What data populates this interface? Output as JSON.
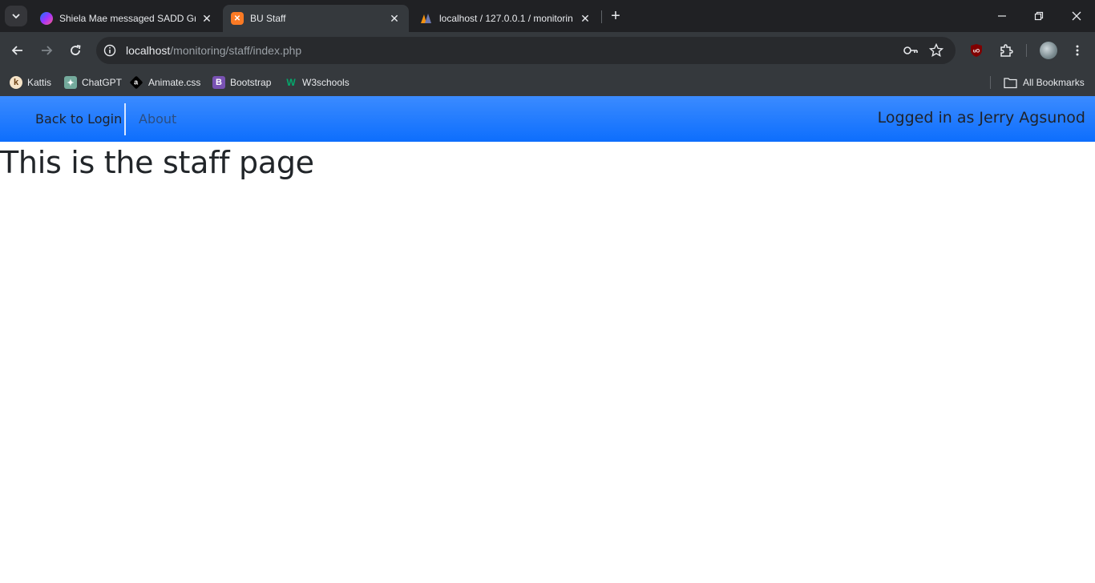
{
  "browser": {
    "tabs": [
      {
        "title": "Shiela Mae messaged SADD Gr",
        "favicon": "messenger-icon",
        "active": false
      },
      {
        "title": "BU Staff",
        "favicon": "xampp-icon",
        "active": true
      },
      {
        "title": "localhost / 127.0.0.1 / monitorin",
        "favicon": "phpmyadmin-icon",
        "active": false
      }
    ],
    "address": {
      "host": "localhost",
      "path": "/monitoring/staff/index.php"
    },
    "bookmarks": [
      {
        "label": "Kattis",
        "icon": "kattis-icon"
      },
      {
        "label": "ChatGPT",
        "icon": "chatgpt-icon"
      },
      {
        "label": "Animate.css",
        "icon": "animate-css-icon"
      },
      {
        "label": "Bootstrap",
        "icon": "bootstrap-icon"
      },
      {
        "label": "W3schools",
        "icon": "w3schools-icon"
      }
    ],
    "all_bookmarks_label": "All Bookmarks"
  },
  "navbar": {
    "back_label": "Back to Login",
    "about_label": "About",
    "user_label": "Logged in as Jerry Agsunod",
    "color": "#0d6efd"
  },
  "page": {
    "heading": "This is the staff page"
  }
}
